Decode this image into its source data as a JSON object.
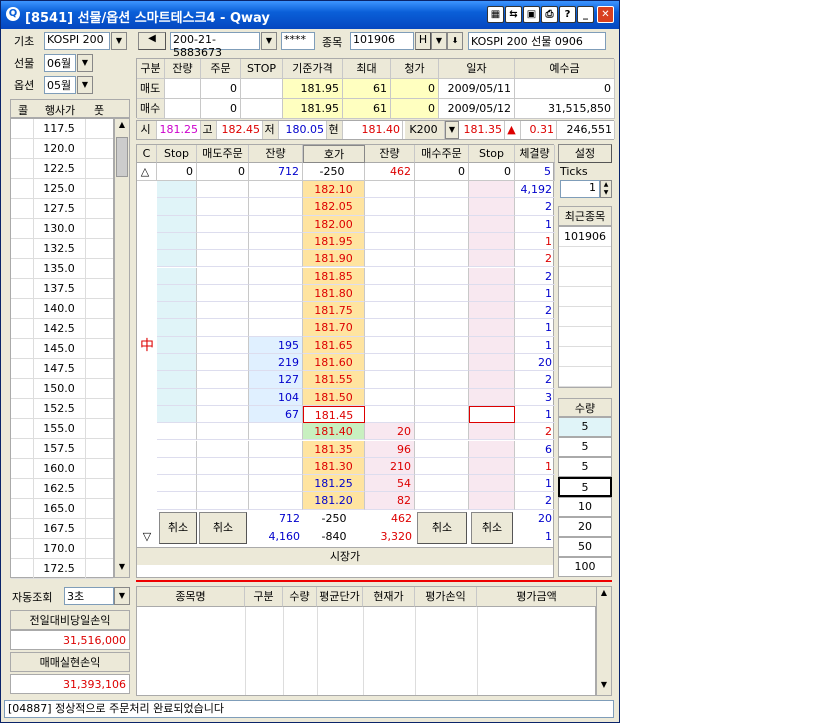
{
  "window": {
    "title": "[8541] 선물/옵션 스마트테스크4 - Qway"
  },
  "left": {
    "base_label": "기초",
    "base_value": "KOSPI 200",
    "fut_label": "선물",
    "fut_value": "06월",
    "opt_label": "옵션",
    "opt_value": "05월",
    "headers": {
      "call": "콜",
      "strike": "행사가",
      "put": "풋"
    },
    "strikes": [
      "117.5",
      "120.0",
      "122.5",
      "125.0",
      "127.5",
      "130.0",
      "132.5",
      "135.0",
      "137.5",
      "140.0",
      "142.5",
      "145.0",
      "147.5",
      "150.0",
      "152.5",
      "155.0",
      "157.5",
      "160.0",
      "162.5",
      "165.0",
      "167.5",
      "170.0",
      "172.5"
    ],
    "auto_label": "자동조회",
    "auto_value": "3초",
    "prev_pnl_label": "전일대비당일손익",
    "prev_pnl_value": "31,516,000",
    "real_pnl_label": "매매실현손익",
    "real_pnl_value": "31,393,106"
  },
  "topbar": {
    "account": "200-21-5883673",
    "password": "****",
    "code_label": "종목",
    "code": "101906",
    "h_label": "H",
    "name": "KOSPI 200 선물 0906"
  },
  "info_table": {
    "headers": [
      "구분",
      "잔량",
      "주문",
      "STOP",
      "기준가격",
      "최대",
      "청가",
      "일자",
      "예수금"
    ],
    "rows": [
      [
        "매도",
        "",
        "0",
        "",
        "181.95",
        "61",
        "0",
        "2009/05/11",
        "0"
      ],
      [
        "매수",
        "",
        "0",
        "",
        "181.95",
        "61",
        "0",
        "2009/05/12",
        "31,515,850"
      ]
    ]
  },
  "price_bar": {
    "open_label": "시",
    "open": "181.25",
    "high_label": "고",
    "high": "182.45",
    "low_label": "저",
    "low": "180.05",
    "cur_label": "현",
    "cur": "181.40",
    "idx_label": "K200",
    "idx": "181.35",
    "arrow": "▲",
    "change": "0.31",
    "volume": "246,551"
  },
  "book": {
    "headers": [
      "C",
      "Stop",
      "매도주문",
      "잔량",
      "호가",
      "잔량",
      "매수주문",
      "Stop",
      "체결량"
    ],
    "top_row": [
      "△",
      "0",
      "0",
      "712",
      "-250",
      "462",
      "0",
      "0",
      "5"
    ],
    "ask_prices": [
      "182.10",
      "182.05",
      "182.00",
      "181.95",
      "181.90",
      "181.85",
      "181.80",
      "181.75",
      "181.70",
      "181.65",
      "181.60",
      "181.55",
      "181.50",
      "181.45"
    ],
    "ask_qty": [
      "",
      "",
      "",
      "",
      "",
      "",
      "",
      "",
      "",
      "195",
      "219",
      "127",
      "104",
      "67"
    ],
    "bid_prices": [
      "181.40",
      "181.35",
      "181.30",
      "181.25",
      "181.20"
    ],
    "bid_qty": [
      "20",
      "96",
      "210",
      "54",
      "82"
    ],
    "fills": [
      "4,192",
      "2",
      "1",
      "1",
      "2",
      "2",
      "1",
      "2",
      "1",
      "1",
      "20",
      "2",
      "3",
      "1",
      "2",
      "6",
      "1",
      "1",
      "2"
    ],
    "fills_red": [
      false,
      false,
      false,
      true,
      true,
      false,
      false,
      false,
      false,
      false,
      false,
      false,
      false,
      false,
      true,
      false,
      true,
      false,
      false
    ],
    "marker": "中",
    "cancel": "취소",
    "sum_row1": {
      "ask": "712",
      "hoga": "-250",
      "bid": "462",
      "fill": "20"
    },
    "sum_row2": {
      "ask": "4,160",
      "hoga": "-840",
      "bid": "3,320",
      "fill": "1"
    },
    "down_arrow": "▽",
    "market": "시장가"
  },
  "right_panel": {
    "setting": "설정",
    "ticks_label": "Ticks",
    "ticks_value": "1",
    "recent_label": "최근종목",
    "recent_items": [
      "101906"
    ],
    "qty_label": "수량",
    "qty_values": [
      "5",
      "5",
      "5",
      "5",
      "10",
      "20",
      "50",
      "100"
    ]
  },
  "positions": {
    "headers": [
      "종목명",
      "구분",
      "수량",
      "평균단가",
      "현재가",
      "평가손익",
      "평가금액"
    ]
  },
  "status": {
    "message": "[04887] 정상적으로 주문처리 완료되었습니다"
  }
}
